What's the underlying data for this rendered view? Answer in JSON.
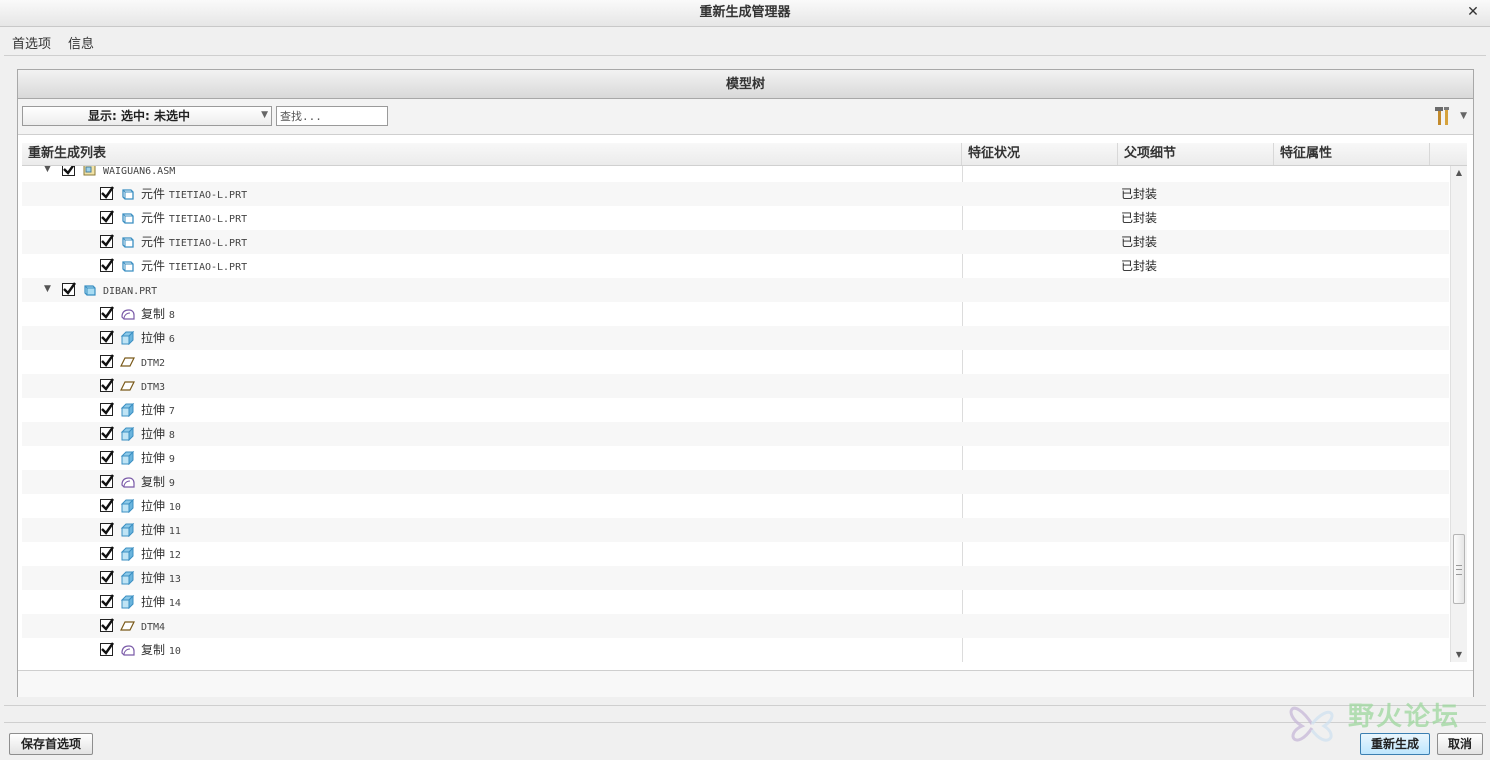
{
  "window": {
    "title": "重新生成管理器"
  },
  "menu": {
    "items": [
      "首选项",
      "信息"
    ]
  },
  "panel": {
    "title": "模型树",
    "display_label": "显示: 选中: 未选中",
    "search_placeholder": "查找..."
  },
  "columns": [
    "重新生成列表",
    "特征状况",
    "父项细节",
    "特征属性"
  ],
  "tree": {
    "rows": [
      {
        "indent": 0,
        "expanded": true,
        "checked": true,
        "icon": "assembly-icon",
        "type": "",
        "name": "WAIGUAN6.ASM",
        "detail": ""
      },
      {
        "indent": 1,
        "checked": true,
        "icon": "part-icon",
        "type": "元件",
        "name": "TIETIAO-L.PRT",
        "detail": "已封装"
      },
      {
        "indent": 1,
        "checked": true,
        "icon": "part-icon",
        "type": "元件",
        "name": "TIETIAO-L.PRT",
        "detail": "已封装"
      },
      {
        "indent": 1,
        "checked": true,
        "icon": "part-icon",
        "type": "元件",
        "name": "TIETIAO-L.PRT",
        "detail": "已封装"
      },
      {
        "indent": 1,
        "checked": true,
        "icon": "part-icon",
        "type": "元件",
        "name": "TIETIAO-L.PRT",
        "detail": "已封装"
      },
      {
        "indent": 0,
        "expanded": true,
        "checked": true,
        "icon": "part-solid-icon",
        "type": "",
        "name": "DIBAN.PRT",
        "detail": ""
      },
      {
        "indent": 1,
        "checked": true,
        "icon": "copy-geometry-icon",
        "type": "复制",
        "name": "8",
        "detail": ""
      },
      {
        "indent": 1,
        "checked": true,
        "icon": "extrude-icon",
        "type": "拉伸",
        "name": "6",
        "detail": ""
      },
      {
        "indent": 1,
        "checked": true,
        "icon": "datum-plane-icon",
        "type": "",
        "name": "DTM2",
        "detail": ""
      },
      {
        "indent": 1,
        "checked": true,
        "icon": "datum-plane-icon",
        "type": "",
        "name": "DTM3",
        "detail": ""
      },
      {
        "indent": 1,
        "checked": true,
        "icon": "extrude-icon",
        "type": "拉伸",
        "name": "7",
        "detail": ""
      },
      {
        "indent": 1,
        "checked": true,
        "icon": "extrude-icon",
        "type": "拉伸",
        "name": "8",
        "detail": ""
      },
      {
        "indent": 1,
        "checked": true,
        "icon": "extrude-icon",
        "type": "拉伸",
        "name": "9",
        "detail": ""
      },
      {
        "indent": 1,
        "checked": true,
        "icon": "copy-geometry-icon",
        "type": "复制",
        "name": "9",
        "detail": ""
      },
      {
        "indent": 1,
        "checked": true,
        "icon": "extrude-icon",
        "type": "拉伸",
        "name": "10",
        "detail": ""
      },
      {
        "indent": 1,
        "checked": true,
        "icon": "extrude-icon",
        "type": "拉伸",
        "name": "11",
        "detail": ""
      },
      {
        "indent": 1,
        "checked": true,
        "icon": "extrude-icon",
        "type": "拉伸",
        "name": "12",
        "detail": ""
      },
      {
        "indent": 1,
        "checked": true,
        "icon": "extrude-icon",
        "type": "拉伸",
        "name": "13",
        "detail": ""
      },
      {
        "indent": 1,
        "checked": true,
        "icon": "extrude-icon",
        "type": "拉伸",
        "name": "14",
        "detail": ""
      },
      {
        "indent": 1,
        "checked": true,
        "icon": "datum-plane-icon",
        "type": "",
        "name": "DTM4",
        "detail": ""
      },
      {
        "indent": 1,
        "checked": true,
        "icon": "copy-geometry-icon",
        "type": "复制",
        "name": "10",
        "detail": ""
      }
    ]
  },
  "buttons": {
    "save_prefs": "保存首选项",
    "regenerate": "重新生成",
    "cancel": "取消"
  },
  "watermark": {
    "text": "野火论坛"
  },
  "colors": {
    "accent_blue": "#bee6fd",
    "watermark_green": "#9ed79e"
  }
}
